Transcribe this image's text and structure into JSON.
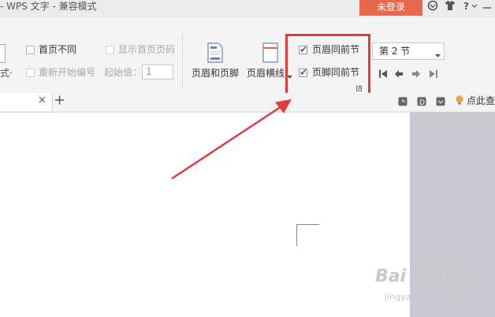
{
  "app": {
    "title": "- WPS 文字 - 兼容模式",
    "login_label": "未登录",
    "help_label": "?"
  },
  "ribbon": {
    "left_partial_label": "式·",
    "diff_first_page": "首页不同",
    "show_first_page_number": "显示首页页码",
    "restart_numbering": "重新开始编号",
    "start_value_label": "起始值：",
    "start_value": "1",
    "header_footer_label": "页眉和页脚",
    "header_line_label": "页眉横线",
    "same_as_prev_header": "页眉同前节",
    "same_as_prev_footer": "页脚同前节",
    "section_select_value": "第 2 节"
  },
  "tabbar": {
    "close_label": "×",
    "add_label": "+",
    "tip_label": "点此查"
  },
  "watermark": {
    "brand": "Bai",
    "brand2": "du",
    "suffix": "经验",
    "url": "jingyan.baidu.com"
  },
  "colors": {
    "login": "#e8674a",
    "highlight": "#e53a3a",
    "check": "#2a64c8"
  }
}
